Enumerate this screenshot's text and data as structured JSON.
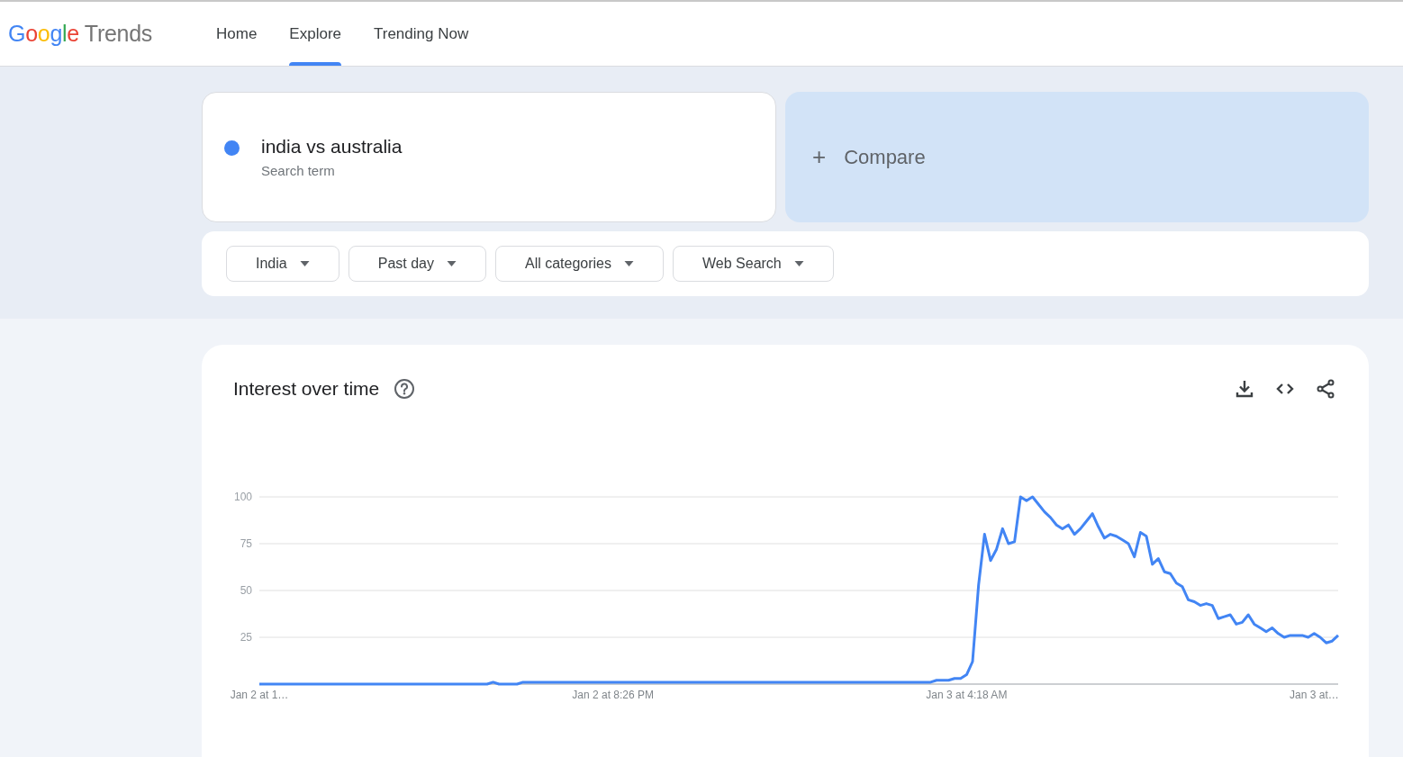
{
  "header": {
    "logo": {
      "brand": "Google",
      "product": "Trends"
    },
    "tabs": [
      {
        "label": "Home",
        "selected": false
      },
      {
        "label": "Explore",
        "selected": true
      },
      {
        "label": "Trending Now",
        "selected": false
      }
    ]
  },
  "search": {
    "term": "india vs australia",
    "term_type": "Search term",
    "color": "#4285f4",
    "compare": {
      "icon": "+",
      "label": "Compare"
    }
  },
  "filters": [
    {
      "label": "India"
    },
    {
      "label": "Past day"
    },
    {
      "label": "All categories"
    },
    {
      "label": "Web Search"
    }
  ],
  "interest_over_time": {
    "title": "Interest over time",
    "chart_data": {
      "type": "line",
      "categories": [
        "Jan 2 at 1…",
        null,
        null,
        null,
        null,
        null,
        null,
        null,
        null,
        null,
        null,
        null,
        null,
        null,
        null,
        null,
        null,
        null,
        null,
        null,
        null,
        null,
        null,
        null,
        null,
        null,
        null,
        null,
        null,
        null,
        null,
        null,
        null,
        null,
        null,
        null,
        null,
        null,
        null,
        null,
        null,
        null,
        null,
        null,
        null,
        null,
        null,
        null,
        null,
        null,
        null,
        null,
        null,
        null,
        null,
        null,
        null,
        null,
        null,
        "Jan 2 at 8:26 PM",
        null,
        null,
        null,
        null,
        null,
        null,
        null,
        null,
        null,
        null,
        null,
        null,
        null,
        null,
        null,
        null,
        null,
        null,
        null,
        null,
        null,
        null,
        null,
        null,
        null,
        null,
        null,
        null,
        null,
        null,
        null,
        null,
        null,
        null,
        null,
        null,
        null,
        null,
        null,
        null,
        null,
        null,
        null,
        null,
        null,
        null,
        null,
        null,
        null,
        null,
        null,
        null,
        null,
        null,
        null,
        null,
        null,
        null,
        "Jan 3 at 4:18 AM",
        null,
        null,
        null,
        null,
        null,
        null,
        null,
        null,
        null,
        null,
        null,
        null,
        null,
        null,
        null,
        null,
        null,
        null,
        null,
        null,
        null,
        null,
        null,
        null,
        null,
        null,
        null,
        null,
        null,
        null,
        null,
        null,
        null,
        null,
        null,
        null,
        null,
        null,
        null,
        null,
        null,
        null,
        null,
        null,
        null,
        null,
        null,
        null,
        null,
        null,
        null,
        null,
        null,
        null,
        null,
        null,
        null,
        "Jan 3 at…",
        null,
        null,
        null,
        null
      ],
      "series": [
        {
          "color": "#4285f4",
          "values": [
            0,
            0,
            0,
            0,
            0,
            0,
            0,
            0,
            0,
            0,
            0,
            0,
            0,
            0,
            0,
            0,
            0,
            0,
            0,
            0,
            0,
            0,
            0,
            0,
            0,
            0,
            0,
            0,
            0,
            0,
            0,
            0,
            0,
            0,
            0,
            0,
            0,
            0,
            0,
            1,
            0,
            0,
            0,
            0,
            1,
            1,
            1,
            1,
            1,
            1,
            1,
            1,
            1,
            1,
            1,
            1,
            1,
            1,
            1,
            1,
            1,
            1,
            1,
            1,
            1,
            1,
            1,
            1,
            1,
            1,
            1,
            1,
            1,
            1,
            1,
            1,
            1,
            1,
            1,
            1,
            1,
            1,
            1,
            1,
            1,
            1,
            1,
            1,
            1,
            1,
            1,
            1,
            1,
            1,
            1,
            1,
            1,
            1,
            1,
            1,
            1,
            1,
            1,
            1,
            1,
            1,
            1,
            1,
            1,
            1,
            1,
            1,
            1,
            2,
            2,
            2,
            3,
            3,
            5,
            12,
            53,
            80,
            66,
            72,
            83,
            75,
            76,
            100,
            98,
            100,
            96,
            92,
            89,
            85,
            83,
            85,
            80,
            83,
            87,
            91,
            84,
            78,
            80,
            79,
            77,
            75,
            68,
            81,
            79,
            64,
            67,
            60,
            59,
            54,
            52,
            45,
            44,
            42,
            43,
            42,
            35,
            36,
            37,
            32,
            33,
            37,
            32,
            30,
            28,
            30,
            27,
            25,
            26,
            26,
            26,
            25,
            27,
            25,
            22,
            23,
            26
          ]
        }
      ],
      "grid": true,
      "ylim": [
        0,
        100
      ],
      "yticks": [
        25,
        50,
        75,
        100
      ]
    }
  }
}
